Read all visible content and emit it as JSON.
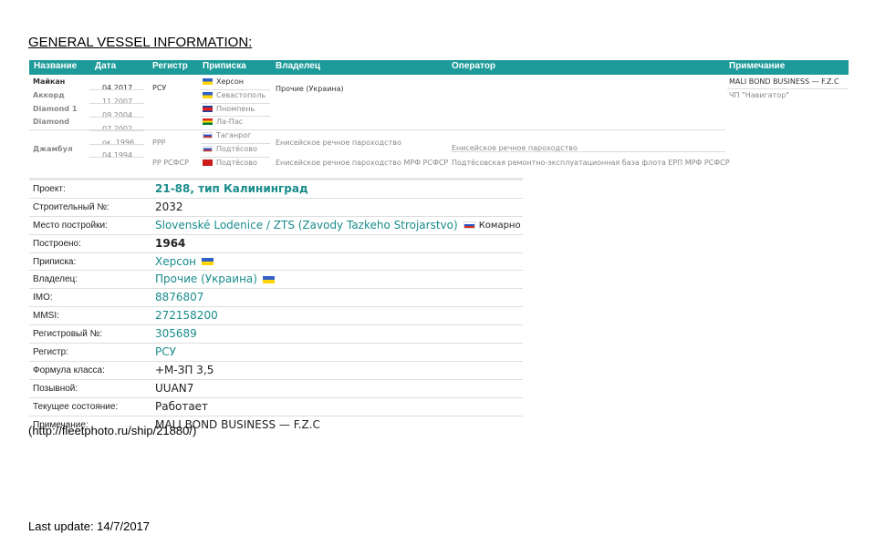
{
  "section_title": "GENERAL VESSEL INFORMATION:",
  "history": {
    "headers": [
      "Название",
      "Дата",
      "Регистр",
      "Приписка",
      "Владелец",
      "Оператор",
      "Примечание"
    ],
    "names": [
      "Майкан",
      "Аккорд",
      "Diamond 1",
      "Diamond",
      "Джамбул"
    ],
    "dates": [
      "04.2017",
      "11.2007",
      "09.2004",
      "07.2002",
      "ок. 1996",
      "04.1994"
    ],
    "registers": [
      "РСУ",
      "РРР",
      "РР РСФСР"
    ],
    "ports": [
      "Херсон",
      "Севастополь",
      "Пномпень",
      "Ла-Пас",
      "Таганрог",
      "Подтёсово",
      "Подтёсово"
    ],
    "owners": [
      "Прочие (Украина)",
      "Енисейское речное пароходство",
      "Енисейское речное пароходство МРФ РСФСР"
    ],
    "operators": [
      "Енисейское речное пароходство",
      "Подтёсовская ремонтно-эксплуатационная база флота ЕРП МРФ РСФСР"
    ],
    "notes": [
      "MALI BOND BUSINESS — F.Z.C",
      "ЧП \"Навигатор\""
    ]
  },
  "details": {
    "project_label": "Проект:",
    "project_value": "21-88, тип Калининград",
    "build_no_label": "Строительный №:",
    "build_no_value": "2032",
    "yard_label": "Место постройки:",
    "yard_value": "Slovenské Lodenice / ZTS (Zavody Tazkeho Strojarstvo)",
    "yard_city": "Комарно",
    "built_label": "Построено:",
    "built_value": "1964",
    "port_label": "Приписка:",
    "port_value": "Херсон",
    "owner_label": "Владелец:",
    "owner_value": "Прочие (Украина)",
    "imo_label": "IMO:",
    "imo_value": "8876807",
    "mmsi_label": "MMSI:",
    "mmsi_value": "272158200",
    "reg_no_label": "Регистровый №:",
    "reg_no_value": "305689",
    "register_label": "Регистр:",
    "register_value": "РСУ",
    "class_label": "Формула класса:",
    "class_value": "+М-ЗП 3,5",
    "callsign_label": "Позывной:",
    "callsign_value": "UUAN7",
    "status_label": "Текущее состояние:",
    "status_value": "Работает",
    "note_label": "Примечание:",
    "note_value": "MALI BOND BUSINESS — F.Z.C"
  },
  "source": "(http://fleetphoto.ru/ship/21880/)",
  "last_update": "Last update: 14/7/2017",
  "colors": {
    "header": "#1d9a9a",
    "link": "#1a8c8c"
  },
  "flags": [
    "ukraine-flag",
    "cambodia-flag",
    "bolivia-flag",
    "russia-flag",
    "ussr-flag",
    "slovakia-flag"
  ]
}
